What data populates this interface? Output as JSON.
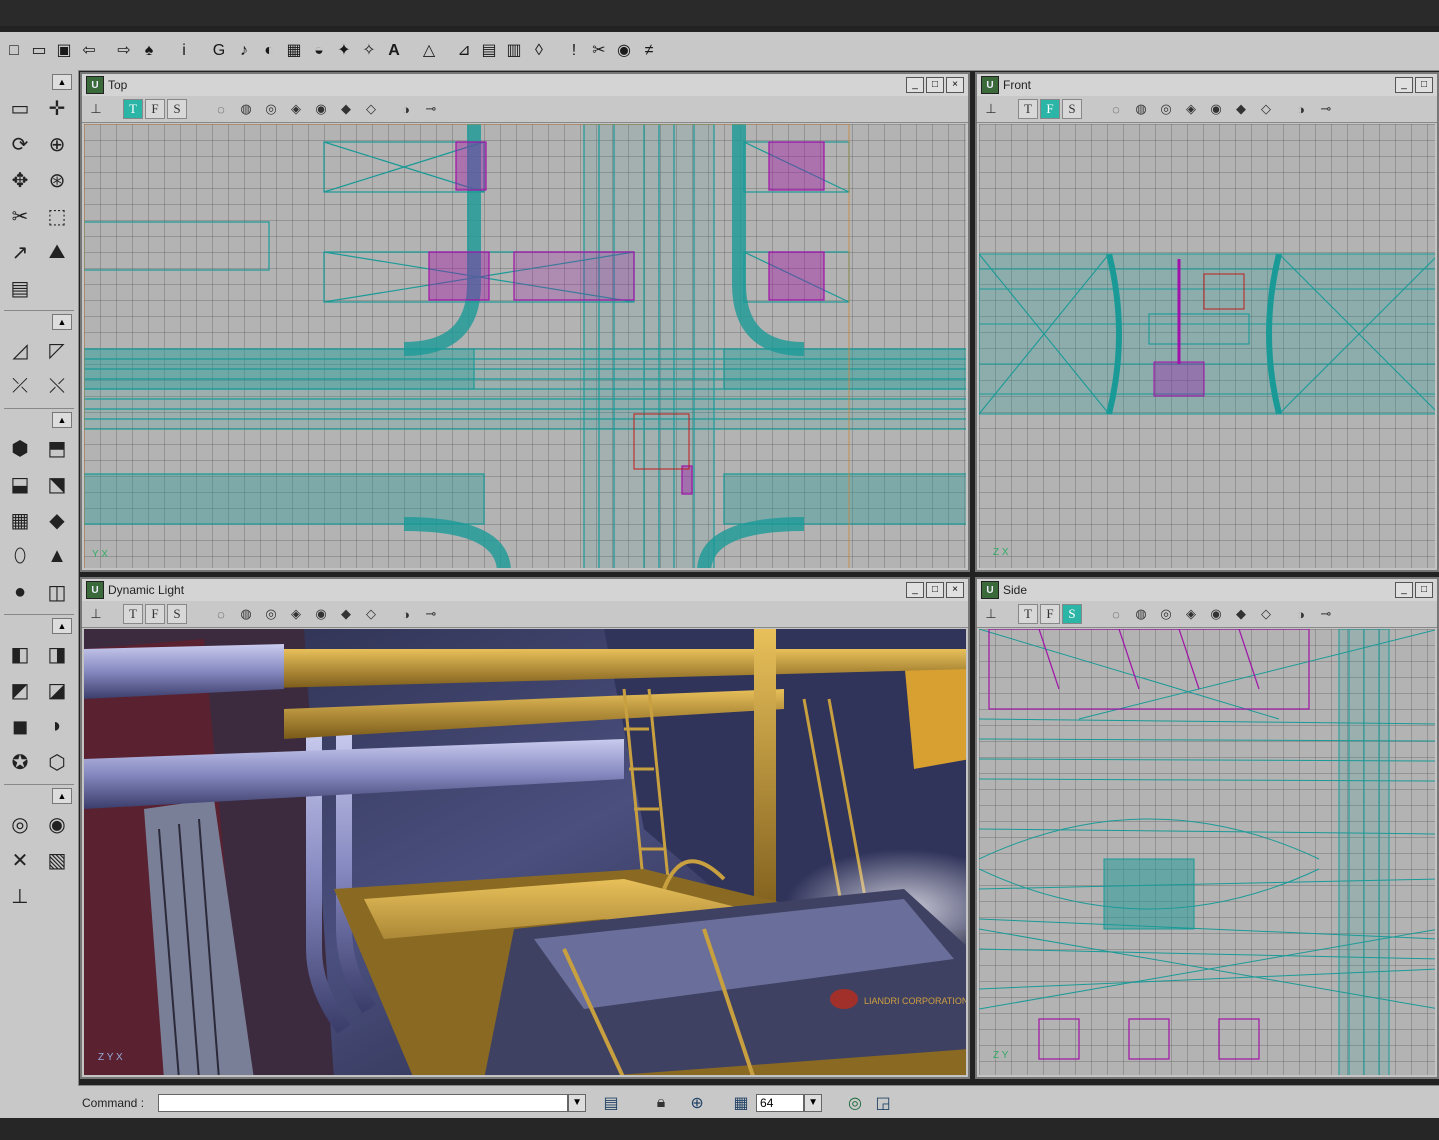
{
  "toolbar": {
    "icons": [
      "new-icon",
      "open-icon",
      "save-icon",
      "undo-icon",
      "redo-icon",
      "find-icon",
      "info-icon",
      "actor-browser-icon",
      "sound-browser-icon",
      "music-browser-icon",
      "texture-browser-icon",
      "mesh-browser-icon",
      "prefab-browser-icon",
      "group-browser-icon",
      "text-icon",
      "build-geometry-icon",
      "build-lighting-icon",
      "build-paths-icon",
      "build-all-icon",
      "play-icon",
      "properties-icon",
      "surface-icon",
      "lighting-icon",
      "actor-icon"
    ],
    "glyphs": [
      "□",
      "▭",
      "▣",
      "⇦",
      "⇨",
      "♠",
      "i",
      "G",
      "♪",
      "◐",
      "▦",
      "◒",
      "✦",
      "✧",
      "A",
      "△",
      "⊿",
      "▤",
      "▥",
      "◊",
      "!",
      "✂",
      "◉",
      "≠",
      "⊥"
    ],
    "text_label": "A"
  },
  "left_panel": {
    "buttons": [
      {
        "name": "camera-move-icon",
        "glyph": "▭"
      },
      {
        "name": "vertex-edit-icon",
        "glyph": "✛"
      },
      {
        "name": "brush-rotate-icon",
        "glyph": "⟳"
      },
      {
        "name": "scale-icon",
        "glyph": "⊕"
      },
      {
        "name": "pan-icon",
        "glyph": "✥"
      },
      {
        "name": "terrain-icon",
        "glyph": "⊛"
      },
      {
        "name": "brush-clip-icon",
        "glyph": "✂"
      },
      {
        "name": "select-box-icon",
        "glyph": "⬚"
      },
      {
        "name": "texture-pan-icon",
        "glyph": "↗"
      },
      {
        "name": "terrain-edit-icon",
        "glyph": "⛰"
      },
      {
        "name": "matinee-icon",
        "glyph": "▤"
      },
      {
        "name": "polygon-icon",
        "glyph": "◿"
      },
      {
        "name": "polygon-clip-icon",
        "glyph": "◸"
      },
      {
        "name": "split-icon",
        "glyph": "⤫"
      },
      {
        "name": "cut-icon",
        "glyph": "⤬"
      },
      {
        "name": "cube-icon",
        "glyph": "⬢"
      },
      {
        "name": "stairs-icon",
        "glyph": "⬒"
      },
      {
        "name": "curved-stairs-icon",
        "glyph": "⬓"
      },
      {
        "name": "spiral-stairs-icon",
        "glyph": "⬔"
      },
      {
        "name": "sheet-icon",
        "glyph": "▦"
      },
      {
        "name": "plane-icon",
        "glyph": "◆"
      },
      {
        "name": "cylinder-icon",
        "glyph": "⬯"
      },
      {
        "name": "cone-icon",
        "glyph": "▲"
      },
      {
        "name": "sphere-icon",
        "glyph": "●"
      },
      {
        "name": "volumetric-icon",
        "glyph": "◫"
      },
      {
        "name": "add-brush-icon",
        "glyph": "◧"
      },
      {
        "name": "subtract-brush-icon",
        "glyph": "◨"
      },
      {
        "name": "intersect-icon",
        "glyph": "◩"
      },
      {
        "name": "deintersect-icon",
        "glyph": "◪"
      },
      {
        "name": "add-special-icon",
        "glyph": "◼"
      },
      {
        "name": "add-mover-icon",
        "glyph": "◗"
      },
      {
        "name": "static-mesh-icon",
        "glyph": "✪"
      },
      {
        "name": "add-volume-icon",
        "glyph": "⬡"
      },
      {
        "name": "show-selected-icon",
        "glyph": "◎"
      },
      {
        "name": "hide-selected-icon",
        "glyph": "◉"
      },
      {
        "name": "select-invert-icon",
        "glyph": "✕"
      },
      {
        "name": "show-all-icon",
        "glyph": "▧"
      },
      {
        "name": "camera-speed-icon",
        "glyph": "⊥"
      }
    ]
  },
  "viewports": [
    {
      "id": "top",
      "title": "Top",
      "tool_labels": [
        "T",
        "F",
        "S"
      ],
      "active": "T",
      "axis": [
        "Y",
        "X"
      ]
    },
    {
      "id": "front",
      "title": "Front",
      "tool_labels": [
        "T",
        "F",
        "S"
      ],
      "active": "F",
      "axis": [
        "Z",
        "X"
      ]
    },
    {
      "id": "dynamic",
      "title": "Dynamic Light",
      "tool_labels": [
        "T",
        "F",
        "S"
      ],
      "active": "",
      "axis": [
        "Z",
        "Y",
        "X"
      ]
    },
    {
      "id": "side",
      "title": "Side",
      "tool_labels": [
        "T",
        "F",
        "S"
      ],
      "active": "S",
      "axis": [
        "Z",
        "Y"
      ]
    }
  ],
  "window_controls": {
    "minimize": "_",
    "maximize": "□",
    "close": "×"
  },
  "viewport_tools": {
    "glyphs": [
      "⊥",
      "◌",
      "◍",
      "◎",
      "◈",
      "◉",
      "◆",
      "◇",
      "◑",
      "⊸"
    ]
  },
  "scene": {
    "signage_text": "LIANDRI CORPORATION"
  },
  "status": {
    "command_label": "Command :",
    "command_value": "",
    "grid_size": "64"
  },
  "colors": {
    "wire_teal": "#1a9a97",
    "wire_magenta": "#a012a8",
    "wire_orange": "#c8843a",
    "panel_gray": "#c8c8c8"
  }
}
